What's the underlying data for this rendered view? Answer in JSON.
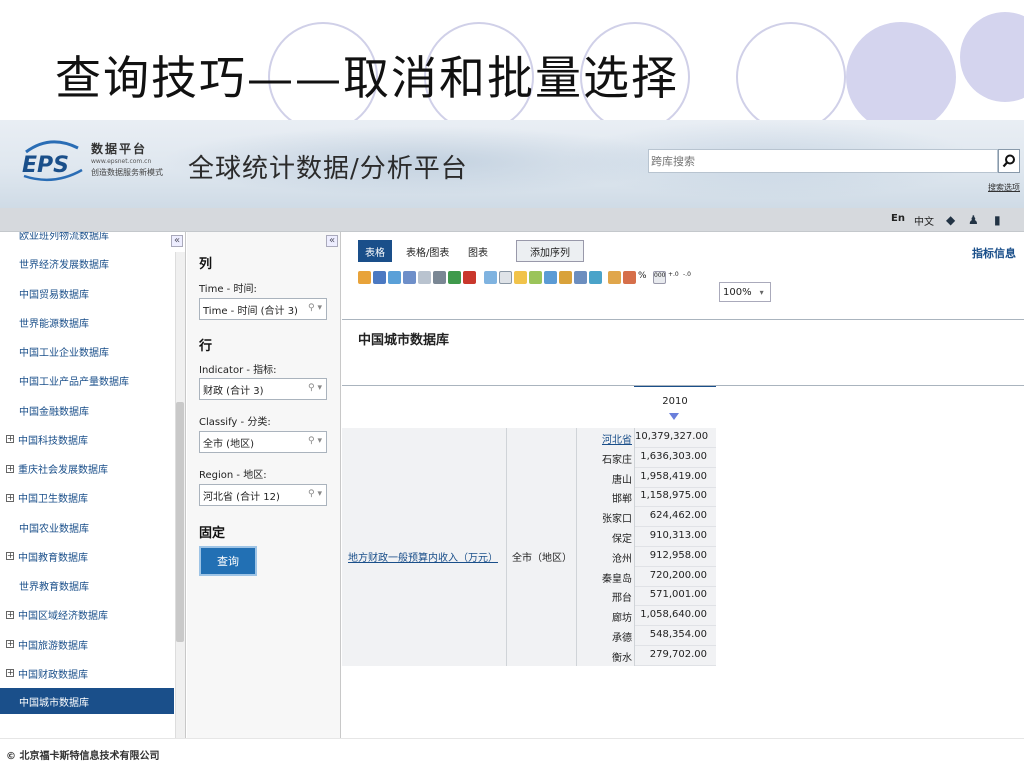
{
  "slide": {
    "title": "查询技巧——取消和批量选择"
  },
  "header": {
    "logo": {
      "line1": "数据平台",
      "line2": "www.epsnet.com.cn",
      "line3": "创造数据服务新模式"
    },
    "app_title": "全球统计数据/分析平台",
    "search_placeholder": "跨库搜索",
    "search_link": "搜索选项"
  },
  "topbar": {
    "lang_en": "En",
    "lang_zh": "中文",
    "icons": [
      "back-arrow-icon",
      "users-icon",
      "document-icon"
    ]
  },
  "db_list": {
    "items": [
      {
        "label": "欧亚班列物流数据库",
        "expandable": false,
        "active": false
      },
      {
        "label": "世界经济发展数据库",
        "expandable": false,
        "active": false
      },
      {
        "label": "中国贸易数据库",
        "expandable": false,
        "active": false
      },
      {
        "label": "世界能源数据库",
        "expandable": false,
        "active": false
      },
      {
        "label": "中国工业企业数据库",
        "expandable": false,
        "active": false
      },
      {
        "label": "中国工业产品产量数据库",
        "expandable": false,
        "active": false
      },
      {
        "label": "中国金融数据库",
        "expandable": false,
        "active": false
      },
      {
        "label": "中国科技数据库",
        "expandable": true,
        "active": false
      },
      {
        "label": "重庆社会发展数据库",
        "expandable": true,
        "active": false
      },
      {
        "label": "中国卫生数据库",
        "expandable": true,
        "active": false
      },
      {
        "label": "中国农业数据库",
        "expandable": false,
        "active": false
      },
      {
        "label": "中国教育数据库",
        "expandable": true,
        "active": false
      },
      {
        "label": "世界教育数据库",
        "expandable": false,
        "active": false
      },
      {
        "label": "中国区域经济数据库",
        "expandable": true,
        "active": false
      },
      {
        "label": "中国旅游数据库",
        "expandable": true,
        "active": false
      },
      {
        "label": "中国财政数据库",
        "expandable": true,
        "active": false
      },
      {
        "label": "中国城市数据库",
        "expandable": false,
        "active": true
      }
    ]
  },
  "dims": {
    "col_heading": "列",
    "time_label": "Time - 时间:",
    "time_value": "Time - 时间 (合计 3)",
    "row_heading": "行",
    "indicator_label": "Indicator - 指标:",
    "indicator_value": "财政 (合计 3)",
    "classify_label": "Classify - 分类:",
    "classify_value": "全市 (地区)",
    "region_label": "Region - 地区:",
    "region_value": "河北省 (合计 12)",
    "fixed_heading": "固定",
    "query_button": "查询"
  },
  "main": {
    "tabs": [
      "表格",
      "表格/图表",
      "图表",
      "添加序列"
    ],
    "indicator_info": "指标信息",
    "zoom": "100%",
    "table_title": "中国城市数据库",
    "year": "2010",
    "indicator_name": "地方财政一般预算内收入（万元）",
    "classify": "全市（地区）",
    "rows": [
      {
        "city": "河北省",
        "value": "10,379,327.00",
        "link": true
      },
      {
        "city": "石家庄",
        "value": "1,636,303.00",
        "link": false
      },
      {
        "city": "唐山",
        "value": "1,958,419.00",
        "link": false
      },
      {
        "city": "邯郸",
        "value": "1,158,975.00",
        "link": false
      },
      {
        "city": "张家口",
        "value": "624,462.00",
        "link": false
      },
      {
        "city": "保定",
        "value": "910,313.00",
        "link": false
      },
      {
        "city": "沧州",
        "value": "912,958.00",
        "link": false
      },
      {
        "city": "秦皇岛",
        "value": "720,200.00",
        "link": false
      },
      {
        "city": "邢台",
        "value": "571,001.00",
        "link": false
      },
      {
        "city": "廊坊",
        "value": "1,058,640.00",
        "link": false
      },
      {
        "city": "承德",
        "value": "548,354.00",
        "link": false
      },
      {
        "city": "衡水",
        "value": "279,702.00",
        "link": false
      }
    ]
  },
  "footer": {
    "copyright": "© 北京福卡斯特信息技术有限公司"
  },
  "colors": {
    "brand_blue": "#1a4f8a",
    "button_blue": "#2270b4",
    "slide_circle": "#d4d4ee"
  }
}
